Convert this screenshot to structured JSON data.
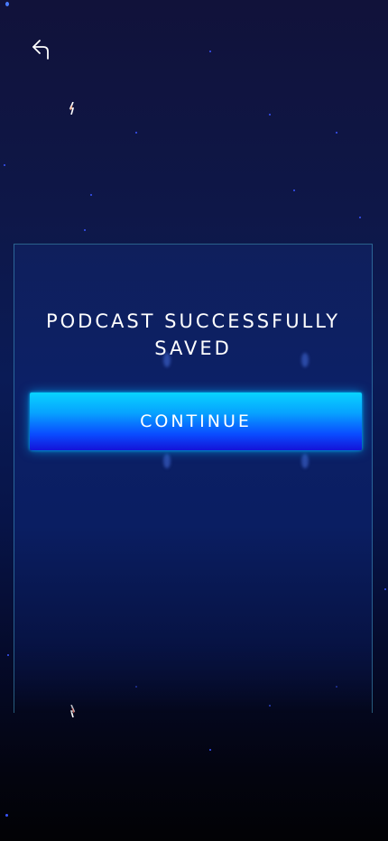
{
  "header": {
    "back_icon": "back-arrow-icon"
  },
  "dialog": {
    "title": "PODCAST SUCCESSFULLY SAVED",
    "continue_label": "CONTINUE"
  },
  "colors": {
    "background_top": "#11123a",
    "background_bottom": "#020205",
    "card_border": "#46a0c8",
    "button_top": "#08d3ff",
    "button_bottom": "#1413d8",
    "text": "#ffffff"
  }
}
